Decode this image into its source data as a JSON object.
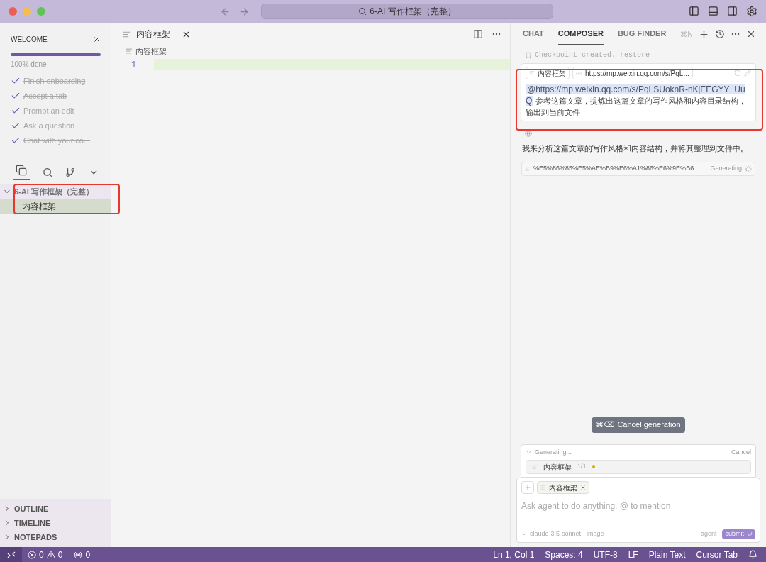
{
  "window": {
    "title": "6-AI 写作框架（完整）"
  },
  "welcome": {
    "title": "WELCOME",
    "level": 1,
    "progress_text": "100% done",
    "tasks": [
      {
        "label": "Finish onboarding",
        "checked": true
      },
      {
        "label": "Accept a tab",
        "checked": true
      },
      {
        "label": "Prompt an edit",
        "checked": true
      },
      {
        "label": "Ask a question",
        "checked": true
      },
      {
        "label": "Chat with your co...",
        "checked": true
      }
    ]
  },
  "explorer": {
    "folder": "6-AI 写作框架（完整）",
    "expanded": true,
    "files": [
      {
        "name": "内容框架",
        "selected": true
      }
    ]
  },
  "sidebar_sections": [
    {
      "label": "OUTLINE",
      "expanded": false
    },
    {
      "label": "TIMELINE",
      "expanded": false
    },
    {
      "label": "NOTEPADS",
      "expanded": false
    }
  ],
  "editor": {
    "tab": "内容框架",
    "breadcrumb": "内容框架",
    "line_numbers": [
      "1"
    ]
  },
  "composer": {
    "tabs": [
      {
        "label": "CHAT",
        "selected": false
      },
      {
        "label": "COMPOSER",
        "selected": true
      },
      {
        "label": "BUG FINDER",
        "selected": false
      }
    ],
    "shortcut": "⌘N",
    "checkpoint": "Checkpoint created. restore",
    "message": {
      "chips": [
        "内容框架",
        "https://mp.weixin.qq.com/s/PqL..."
      ],
      "mention": "@https://mp.weixin.qq.com/s/PqLSUoknR-nKjEEGYY_UuQ",
      "text": "参考这篇文章，提炼出这篇文章的写作风格和内容目录结构，输出到当前文件"
    },
    "reply": "我来分析这篇文章的写作风格和内容结构，并将其整理到文件中。",
    "file_edit": {
      "name": "%E5%86%85%E5%AE%B9%E6%A1%86%E6%9E%B6",
      "status": "Generating"
    },
    "cancel_tooltip": {
      "keys": "⌘⌫",
      "label": "Cancel generation"
    },
    "generating": {
      "label": "Generating...",
      "cancel": "Cancel",
      "file": "内容框架",
      "count": "1/1"
    },
    "input": {
      "chip": "内容框架",
      "placeholder": "Ask agent to do anything, @ to mention",
      "model": "claude-3.5-sonnet",
      "image": "image",
      "mode": "agent",
      "submit": "submit"
    }
  },
  "status_bar": {
    "errors": "0",
    "warnings": "0",
    "ports": "0",
    "items": [
      "Ln 1, Col 1",
      "Spaces: 4",
      "UTF-8",
      "LF",
      "Plain Text",
      "Cursor Tab"
    ]
  }
}
